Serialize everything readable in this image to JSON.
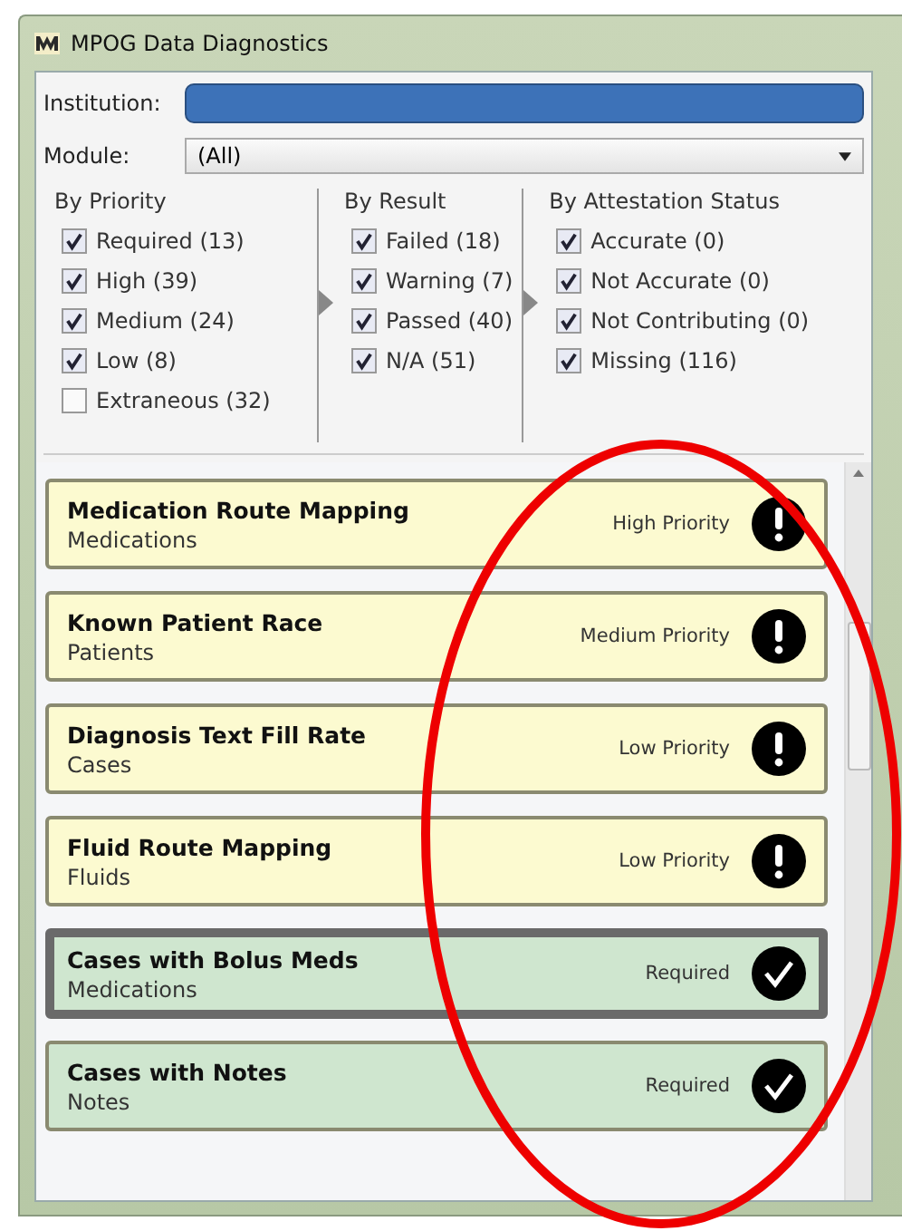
{
  "window": {
    "title": "MPOG Data Diagnostics"
  },
  "institution": {
    "label": "Institution:",
    "selected": true
  },
  "module": {
    "label": "Module:",
    "value": "(All)"
  },
  "filters": [
    {
      "title": "By Priority",
      "items": [
        {
          "label": "Required (13)",
          "checked": true
        },
        {
          "label": "High (39)",
          "checked": true
        },
        {
          "label": "Medium (24)",
          "checked": true
        },
        {
          "label": "Low (8)",
          "checked": true
        },
        {
          "label": "Extraneous (32)",
          "checked": false
        }
      ]
    },
    {
      "title": "By Result",
      "items": [
        {
          "label": "Failed (18)",
          "checked": true
        },
        {
          "label": "Warning (7)",
          "checked": true
        },
        {
          "label": "Passed (40)",
          "checked": true
        },
        {
          "label": "N/A (51)",
          "checked": true
        }
      ]
    },
    {
      "title": "By Attestation Status",
      "items": [
        {
          "label": "Accurate (0)",
          "checked": true
        },
        {
          "label": "Not Accurate (0)",
          "checked": true
        },
        {
          "label": "Not Contributing (0)",
          "checked": true
        },
        {
          "label": "Missing (116)",
          "checked": true
        }
      ]
    }
  ],
  "results": [
    {
      "title": "Medication Route Mapping",
      "module": "Medications",
      "priority": "High Priority",
      "kind": "failed",
      "selected": false
    },
    {
      "title": "Known Patient Race",
      "module": "Patients",
      "priority": "Medium Priority",
      "kind": "failed",
      "selected": false
    },
    {
      "title": "Diagnosis Text Fill Rate",
      "module": "Cases",
      "priority": "Low Priority",
      "kind": "failed",
      "selected": false
    },
    {
      "title": "Fluid Route Mapping",
      "module": "Fluids",
      "priority": "Low Priority",
      "kind": "failed",
      "selected": false
    },
    {
      "title": "Cases with Bolus Meds",
      "module": "Medications",
      "priority": "Required",
      "kind": "passed",
      "selected": true
    },
    {
      "title": "Cases with Notes",
      "module": "Notes",
      "priority": "Required",
      "kind": "passed",
      "selected": false
    }
  ],
  "annotations": [
    {
      "kind": "ellipse",
      "color": "#ee0000"
    }
  ]
}
